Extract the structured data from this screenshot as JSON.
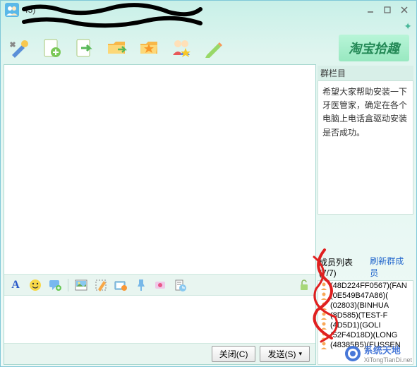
{
  "titlebar": {
    "text": "                                  45)"
  },
  "subheader": "                                                       ",
  "brand": "淘宝拾趣",
  "toolbar_icons": [
    "settings",
    "new-doc",
    "forward",
    "folder",
    "favorite",
    "members",
    "edit"
  ],
  "bulletin": {
    "title": "群栏目",
    "body": "希望大家帮助安装一下牙医管家，确定在各个电脑上电话盒驱动安装是否成功。"
  },
  "members": {
    "title": "成员列表(7/7)",
    "refresh": "刷新群成员",
    "items": [
      "(48D224FF0567)(FAN",
      "(0E549B47A86)(",
      "(02803)(BINHUA",
      "(8D585)(TEST-F",
      "(4D5D1)(GOLI",
      "(52F4D18D)(LONG",
      "(48385B5)(FUSSEN"
    ]
  },
  "format_glyphs": {
    "font": "A"
  },
  "buttons": {
    "close": "关闭(C)",
    "send": "发送(S)"
  },
  "watermark": {
    "brand": "系统天地",
    "url": "XiTongTianDi.net"
  }
}
